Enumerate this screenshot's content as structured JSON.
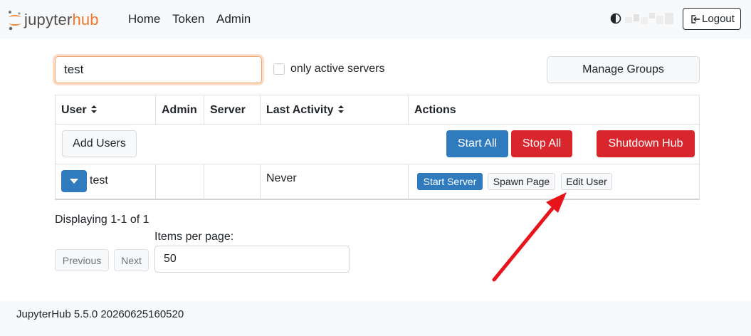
{
  "navbar": {
    "logo_j": "jupyter",
    "logo_hub": "hub",
    "links": [
      "Home",
      "Token",
      "Admin"
    ],
    "logout_label": "Logout"
  },
  "search": {
    "value": "test",
    "only_active_label": "only active servers",
    "manage_groups_label": "Manage Groups"
  },
  "table": {
    "headers": [
      "User",
      "Admin",
      "Server",
      "Last Activity",
      "Actions"
    ],
    "add_users_label": "Add Users",
    "start_all_label": "Start All",
    "stop_all_label": "Stop All",
    "shutdown_hub_label": "Shutdown Hub",
    "rows": [
      {
        "user": "test",
        "admin": "",
        "server": "",
        "last_activity": "Never",
        "actions": [
          "Start Server",
          "Spawn Page",
          "Edit User"
        ]
      }
    ]
  },
  "pagination": {
    "displaying": "Displaying 1-1 of 1",
    "items_per_page_label": "Items per page:",
    "items_per_page_value": "50",
    "previous_label": "Previous",
    "next_label": "Next"
  },
  "footer": {
    "version": "JupyterHub 5.5.0 20260625160520"
  },
  "colors": {
    "primary": "#2f7bbd",
    "danger": "#d9262c",
    "brand": "#f37726",
    "annotation_arrow": "#e8141b"
  },
  "icons": {
    "theme_toggle": "half-circle-icon",
    "logout": "logout-icon",
    "row_toggle": "caret-down-icon",
    "sort": "sort-icon"
  }
}
